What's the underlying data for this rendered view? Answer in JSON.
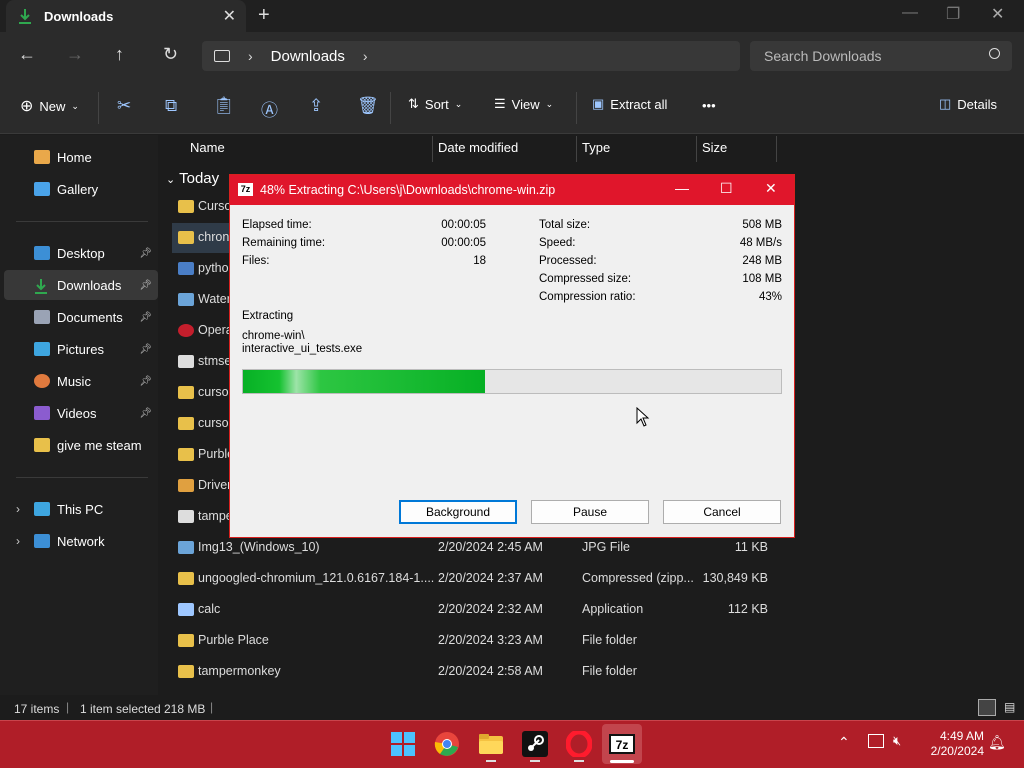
{
  "window": {
    "tab_title": "Downloads",
    "new_tab": "+",
    "close_tab": "✕"
  },
  "nav": {
    "breadcrumb": "Downloads",
    "search_placeholder": "Search Downloads"
  },
  "toolbar": {
    "new_label": "New",
    "sort_label": "Sort",
    "view_label": "View",
    "extract_label": "Extract all",
    "more_label": "•••",
    "details_label": "Details"
  },
  "sidebar": {
    "items": [
      {
        "label": "Home",
        "color": "#e9a84a"
      },
      {
        "label": "Gallery",
        "color": "#4aa3e9"
      },
      {
        "label": "Desktop",
        "color": "#3c8fd6",
        "pinned": true
      },
      {
        "label": "Downloads",
        "color": "#2fa84f",
        "pinned": true
      },
      {
        "label": "Documents",
        "color": "#9aa3b5",
        "pinned": true
      },
      {
        "label": "Pictures",
        "color": "#3ea6e0",
        "pinned": true
      },
      {
        "label": "Music",
        "color": "#e07a3e",
        "pinned": true
      },
      {
        "label": "Videos",
        "color": "#8b5ccf",
        "pinned": true
      },
      {
        "label": "give me steam",
        "color": "#e8c04a"
      },
      {
        "label": "This PC",
        "color": "#3ea6e0"
      },
      {
        "label": "Network",
        "color": "#3c8fd6"
      }
    ]
  },
  "columns": {
    "name": "Name",
    "date": "Date modified",
    "type": "Type",
    "size": "Size"
  },
  "group": "Today",
  "files": [
    {
      "name": "Curso",
      "date": "",
      "type": "",
      "size": "",
      "color": "#e8c04a"
    },
    {
      "name": "chron",
      "date": "",
      "type": "",
      "size": "",
      "color": "#e8c04a"
    },
    {
      "name": "pytho",
      "date": "",
      "type": "",
      "size": "",
      "color": "#4a7ec6"
    },
    {
      "name": "Water",
      "date": "",
      "type": "",
      "size": "",
      "color": "#6ba4d8"
    },
    {
      "name": "Opera",
      "date": "",
      "type": "",
      "size": "",
      "color": "#c41e2c"
    },
    {
      "name": "stmse",
      "date": "",
      "type": "",
      "size": "",
      "color": "#ddd"
    },
    {
      "name": "curso",
      "date": "",
      "type": "",
      "size": "",
      "color": "#e8c04a"
    },
    {
      "name": "curso",
      "date": "",
      "type": "",
      "size": "",
      "color": "#e8c04a"
    },
    {
      "name": "Purble",
      "date": "",
      "type": "",
      "size": "",
      "color": "#e8c04a"
    },
    {
      "name": "Driver",
      "date": "",
      "type": "",
      "size": "",
      "color": "#e0a040"
    },
    {
      "name": "tampe",
      "date": "",
      "type": "",
      "size": "",
      "color": "#ddd"
    },
    {
      "name": "Img13_(Windows_10)",
      "date": "2/20/2024 2:45 AM",
      "type": "JPG File",
      "size": "11 KB",
      "color": "#6ba4d8"
    },
    {
      "name": "ungoogled-chromium_121.0.6167.184-1....",
      "date": "2/20/2024 2:37 AM",
      "type": "Compressed (zipp...",
      "size": "130,849 KB",
      "color": "#e8c04a"
    },
    {
      "name": "calc",
      "date": "2/20/2024 2:32 AM",
      "type": "Application",
      "size": "112 KB",
      "color": "#9ec7ff"
    },
    {
      "name": "Purble Place",
      "date": "2/20/2024 3:23 AM",
      "type": "File folder",
      "size": "",
      "color": "#e8c04a"
    },
    {
      "name": "tampermonkey",
      "date": "2/20/2024 2:58 AM",
      "type": "File folder",
      "size": "",
      "color": "#e8c04a"
    }
  ],
  "status": {
    "items": "17 items",
    "selected": "1 item selected",
    "selected_size": "218 MB"
  },
  "dialog": {
    "title": "48% Extracting C:\\Users\\j\\Downloads\\chrome-win.zip",
    "logo": "7z",
    "elapsed_label": "Elapsed time:",
    "elapsed": "00:00:05",
    "remaining_label": "Remaining time:",
    "remaining": "00:00:05",
    "files_label": "Files:",
    "files": "18",
    "total_label": "Total size:",
    "total": "508 MB",
    "speed_label": "Speed:",
    "speed": "48 MB/s",
    "processed_label": "Processed:",
    "processed": "248 MB",
    "compressed_label": "Compressed size:",
    "compressed": "108 MB",
    "ratio_label": "Compression ratio:",
    "ratio": "43%",
    "operation": "Extracting",
    "path1": "chrome-win\\",
    "path2": "interactive_ui_tests.exe",
    "progress": 0.45,
    "background_btn": "Background",
    "pause_btn": "Pause",
    "cancel_btn": "Cancel"
  },
  "taskbar": {
    "time": "4:49 AM",
    "date": "2/20/2024",
    "accent": "#b01e28"
  }
}
